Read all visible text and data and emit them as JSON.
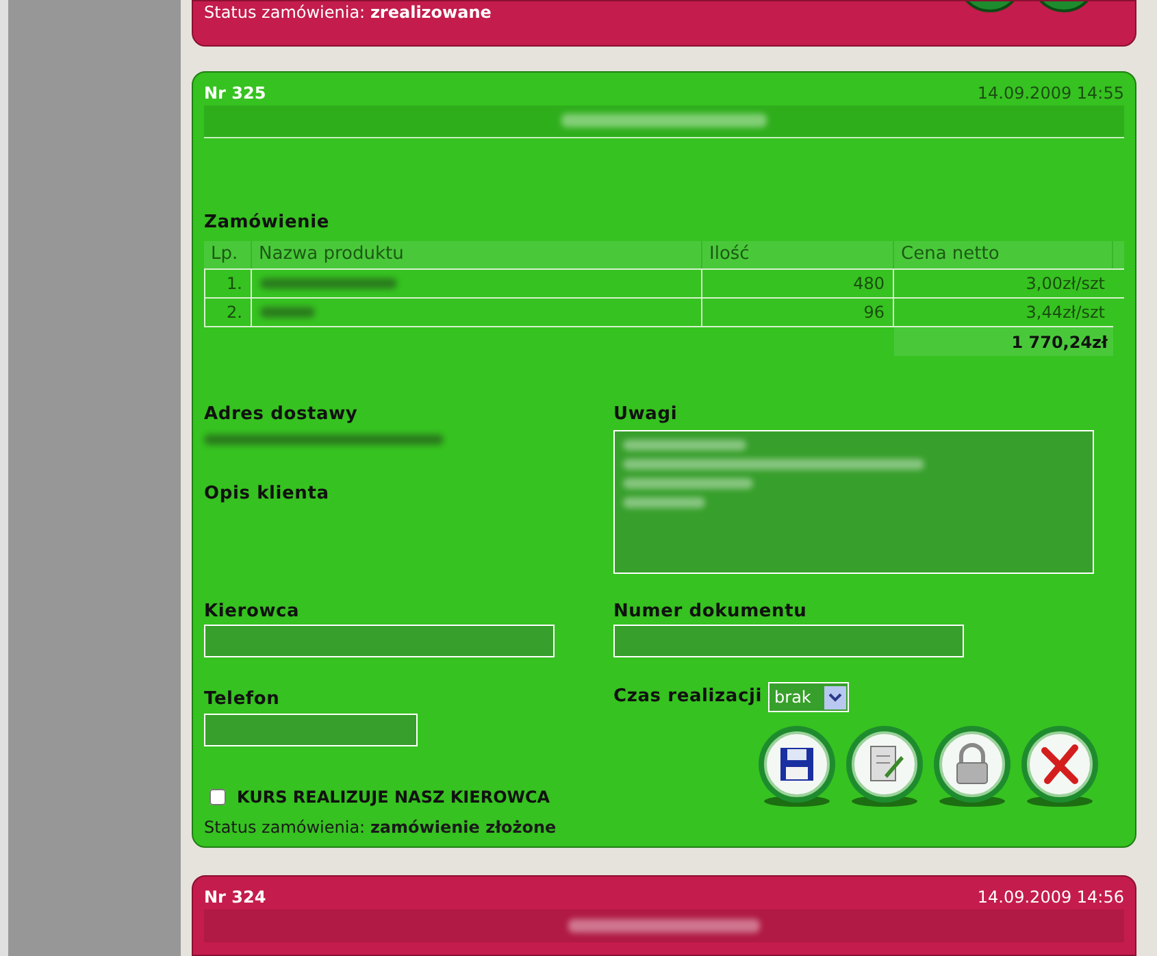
{
  "previous_order": {
    "color": "#c41c4c",
    "status_label": "Status zamówienia:",
    "status_value": "zrealizowane"
  },
  "order": {
    "color": "#36c220",
    "number": "Nr 325",
    "date": "14.09.2009 14:55",
    "section_title": "Zamówienie",
    "table": {
      "columns": [
        "Lp.",
        "Nazwa produktu",
        "Ilość",
        "Cena netto"
      ],
      "rows": [
        {
          "lp": "1.",
          "quantity": "480",
          "price": "3,00zł/szt"
        },
        {
          "lp": "2.",
          "quantity": "96",
          "price": "3,44zł/szt"
        }
      ],
      "total": "1 770,24zł"
    },
    "delivery_label": "Adres dostawy",
    "description_label": "Opis klienta",
    "notes_label": "Uwagi",
    "driver_label": "Kierowca",
    "document_label": "Numer dokumentu",
    "phone_label": "Telefon",
    "time_label": "Czas realizacji",
    "time_value": "brak",
    "own_driver": {
      "label": "KURS REALIZUJE NASZ KIEROWCA",
      "checked": false
    },
    "status_label": "Status zamówienia:",
    "status_value": "zamówienie złożone",
    "actions": [
      {
        "kind": "save"
      },
      {
        "kind": "edit"
      },
      {
        "kind": "lock"
      },
      {
        "kind": "delete"
      }
    ]
  },
  "next_order": {
    "color": "#c41c4c",
    "number": "Nr 324",
    "date": "14.09.2009 14:56"
  }
}
